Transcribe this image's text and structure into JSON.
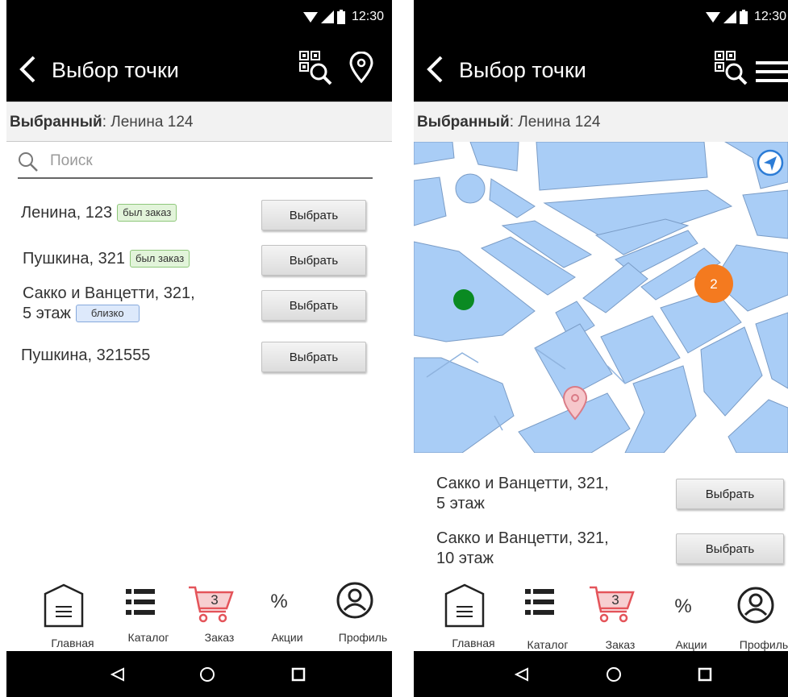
{
  "status": {
    "time": "12:30"
  },
  "screen_a": {
    "title": "Выбор точки",
    "selected": {
      "label": "Выбранный",
      "value": ": Ленина 124"
    },
    "search": {
      "placeholder": "Поиск"
    },
    "items": [
      {
        "address": "Ленина, 123",
        "badge": "был заказ",
        "button": "Выбрать"
      },
      {
        "address": "Пушкина, 321",
        "badge": "был заказ",
        "button": "Выбрать"
      },
      {
        "address_line1": "Сакко и Ванцетти, 321,",
        "address_line2": "5 этаж",
        "badge": "близко",
        "button": "Выбрать"
      },
      {
        "address": "Пушкина, 321555",
        "button": "Выбрать"
      }
    ]
  },
  "screen_b": {
    "title": "Выбор точки",
    "selected": {
      "label": "Выбранный",
      "value": ": Ленина 124"
    },
    "map": {
      "cluster_count": "2"
    },
    "items": [
      {
        "line1": "Сакко и Ванцетти, 321,",
        "line2": "5 этаж",
        "button": "Выбрать"
      },
      {
        "line1": "Сакко и Ванцетти, 321,",
        "line2": "10 этаж",
        "button": "Выбрать"
      }
    ]
  },
  "nav": {
    "items": [
      {
        "label": "Главная",
        "icon": "home-icon"
      },
      {
        "label": "Каталог",
        "icon": "catalog-list-icon"
      },
      {
        "label": "Заказ",
        "icon": "cart-icon",
        "count": "3"
      },
      {
        "label": "Акции",
        "icon": "percent-icon",
        "symbol": "%"
      },
      {
        "label": "Профиль",
        "icon": "profile-icon"
      }
    ]
  },
  "colors": {
    "bar": "#000000",
    "map_block": "#a9cdf6",
    "cluster": "#f47a1f",
    "dot": "#0a8a22",
    "pin": "#e58b94",
    "cart": "#e4545a"
  }
}
